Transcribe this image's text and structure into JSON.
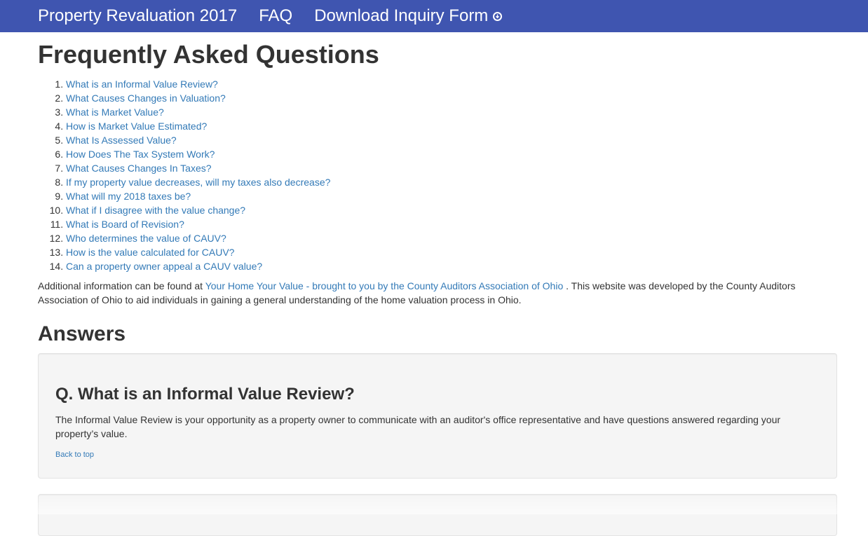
{
  "nav": {
    "brand": "Property Revaluation 2017",
    "faq": "FAQ",
    "download": "Download Inquiry Form",
    "download_icon": "download-circle-icon"
  },
  "page_title": "Frequently Asked Questions",
  "questions": [
    "What is an Informal Value Review?",
    "What Causes Changes in Valuation?",
    "What is Market Value?",
    "How is Market Value Estimated?",
    "What Is Assessed Value?",
    "How Does The Tax System Work?",
    "What Causes Changes In Taxes?",
    "If my property value decreases, will my taxes also decrease?",
    "What will my 2018 taxes be?",
    "What if I disagree with the value change?",
    "What is Board of Revision?",
    "Who determines the value of CAUV?",
    "How is the value calculated for CAUV?",
    "Can a property owner appeal a CAUV value?"
  ],
  "info": {
    "prefix": "Additional information can be found at ",
    "link": "Your Home Your Value - brought to you by the County Auditors Association of Ohio",
    "suffix": " . This website was developed by the County Auditors Association of Ohio to aid individuals in gaining a general understanding of the home valuation process in Ohio."
  },
  "answers_title": "Answers",
  "answers": [
    {
      "question": "Q. What is an Informal Value Review?",
      "answer": "The Informal Value Review is your opportunity as a property owner to communicate with an auditor's office representative and have questions answered regarding your property’s value.",
      "back": "Back to top"
    }
  ],
  "colors": {
    "navbar": "#3f55b0",
    "link": "#337ab7",
    "well": "#f5f5f5"
  }
}
